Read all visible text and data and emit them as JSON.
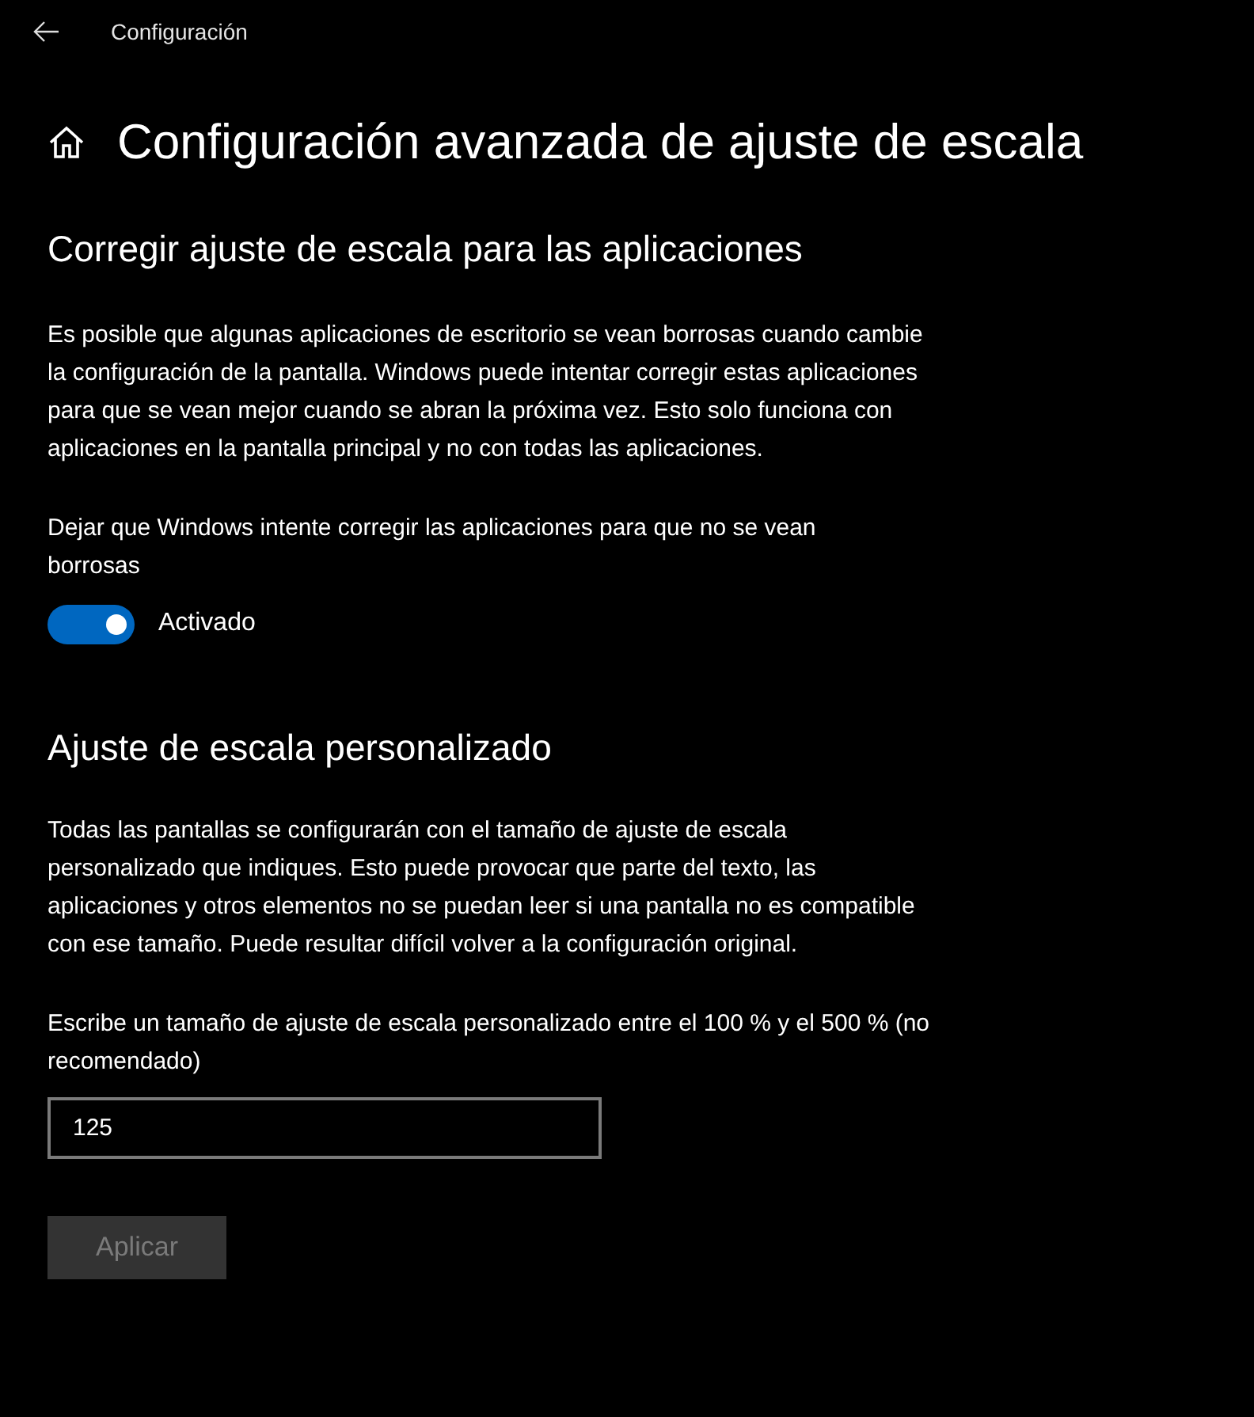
{
  "window": {
    "title": "Configuración"
  },
  "page": {
    "title": "Configuración avanzada de ajuste de escala"
  },
  "fix_section": {
    "heading": "Corregir ajuste de escala para las aplicaciones",
    "description": "Es posible que algunas aplicaciones de escritorio se vean borrosas cuando cambie la configuración de la pantalla. Windows puede intentar corregir estas aplicaciones para que se vean mejor cuando se abran la próxima vez. Esto solo funciona con aplicaciones en la pantalla principal y no con todas las aplicaciones.",
    "toggle_label": "Dejar que Windows intente corregir las aplicaciones para que no se vean borrosas",
    "toggle": {
      "on": true,
      "state_text": "Activado"
    }
  },
  "custom_section": {
    "heading": "Ajuste de escala personalizado",
    "description": "Todas las pantallas se configurarán con el tamaño de ajuste de escala personalizado que indiques. Esto puede provocar que parte del texto, las aplicaciones y otros elementos no se puedan leer si una pantalla no es compatible con ese tamaño. Puede resultar difícil volver a la configuración original.",
    "field_label": "Escribe un tamaño de ajuste de escala personalizado entre el 100 % y el 500 % (no recomendado)",
    "field_value": "125",
    "button": {
      "label": "Aplicar",
      "disabled": true
    }
  }
}
